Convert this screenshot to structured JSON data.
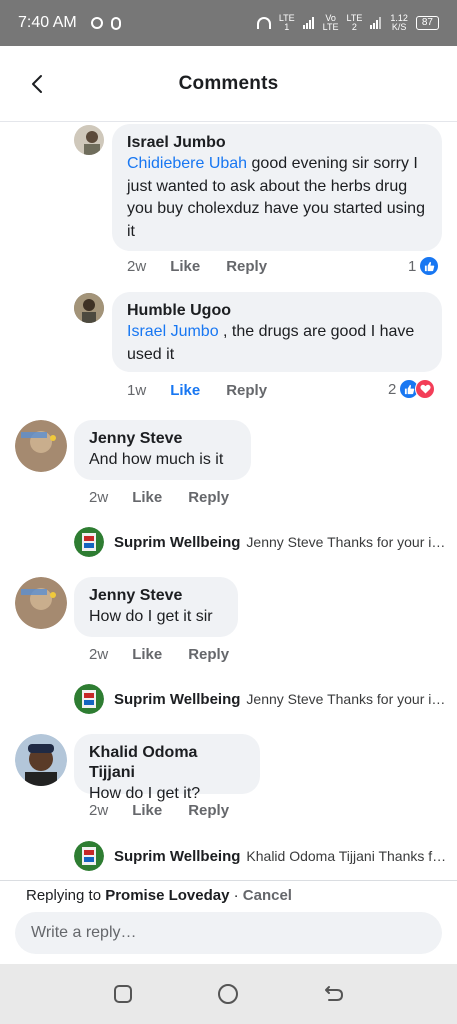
{
  "status_bar": {
    "time": "7:40 AM",
    "net1_top": "LTE",
    "net1_bottom": "1",
    "net2_top": "Vo",
    "net2_bottom": "LTE",
    "net3_top": "LTE",
    "net3_bottom": "2",
    "speed_top": "1.12",
    "speed_bottom": "K/S",
    "battery": "87"
  },
  "header": {
    "title": "Comments"
  },
  "comments": [
    {
      "author": "Israel Jumbo",
      "mention": "Chidiebere Ubah",
      "text": " good evening sir sorry I just wanted to ask about the herbs drug you buy cholexduz have you started using it",
      "time": "2w",
      "like": "Like",
      "reply": "Reply",
      "reaction_count": "1"
    },
    {
      "author": "Humble Ugoo",
      "mention": "Israel Jumbo",
      "text": " , the drugs are good I have used it",
      "time": "1w",
      "like": "Like",
      "reply": "Reply",
      "reaction_count": "2"
    },
    {
      "author": "Jenny Steve",
      "text": "And how much is it",
      "time": "2w",
      "like": "Like",
      "reply": "Reply",
      "reply_preview": {
        "author": "Suprim Wellbeing",
        "text": "Jenny Steve Thanks for your interest"
      }
    },
    {
      "author": "Jenny Steve",
      "text": "How do I get it sir",
      "time": "2w",
      "like": "Like",
      "reply": "Reply",
      "reply_preview": {
        "author": "Suprim Wellbeing",
        "text": "Jenny Steve Thanks for your interest"
      }
    },
    {
      "author": "Khalid Odoma Tijjani",
      "text": "How do I get it?",
      "time": "2w",
      "like": "Like",
      "reply": "Reply",
      "reply_preview": {
        "author": "Suprim Wellbeing",
        "text": "Khalid Odoma Tijjani Thanks for your interest"
      }
    }
  ],
  "composer": {
    "replying_prefix": "Replying to",
    "replying_to": "Promise Loveday",
    "separator": " · ",
    "cancel": "Cancel",
    "placeholder": "Write a reply…"
  },
  "colors": {
    "accent": "#1877f2",
    "love": "#f33e58",
    "bubble": "#f0f2f5",
    "status_bar": "#777777"
  },
  "icons": {
    "back": "chevron-left-icon",
    "like_reaction": "thumbs-up-icon",
    "love_reaction": "heart-icon",
    "nav_recent": "square-icon",
    "nav_home": "circle-icon",
    "nav_back": "back-arrow-icon"
  }
}
